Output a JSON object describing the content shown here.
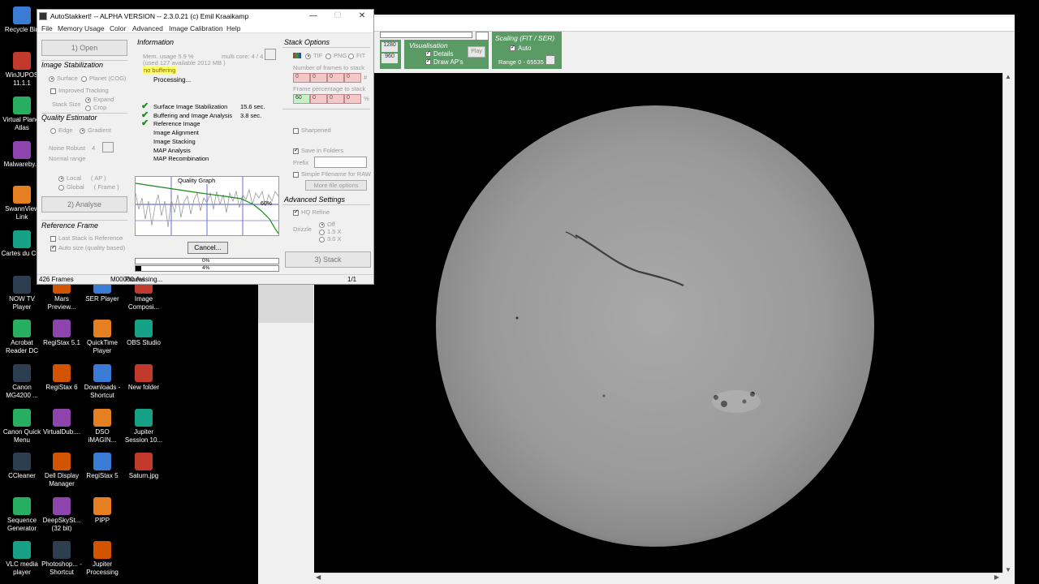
{
  "desktop_icons": [
    {
      "label": "Recycle Bin",
      "icon": "recycle-bin-icon"
    },
    {
      "label": "WinJUPOS 11.1.1",
      "icon": "winjupos-icon"
    },
    {
      "label": "Virtual Planet Atlas",
      "icon": "virtual-planet-atlas-icon"
    },
    {
      "label": "Malwareby...",
      "icon": "malwarebytes-icon"
    },
    {
      "label": "SwannView Link",
      "icon": "swannview-icon"
    },
    {
      "label": "Cartes du Ciel",
      "icon": "cartes-du-ciel-icon"
    },
    {
      "label": "NOW TV Player",
      "icon": "nowtv-icon"
    },
    {
      "label": "Mars Preview...",
      "icon": "mars-preview-icon"
    },
    {
      "label": "SER Player",
      "icon": "ser-player-icon"
    },
    {
      "label": "Image Composi...",
      "icon": "image-composite-icon"
    },
    {
      "label": "Acrobat Reader DC",
      "icon": "acrobat-icon"
    },
    {
      "label": "RegiStax 5.1",
      "icon": "registax-icon"
    },
    {
      "label": "QuickTime Player",
      "icon": "quicktime-icon"
    },
    {
      "label": "OBS Studio",
      "icon": "obs-icon"
    },
    {
      "label": "Canon MG4200 ...",
      "icon": "canon-printer-icon"
    },
    {
      "label": "RegiStax 6",
      "icon": "registax-icon"
    },
    {
      "label": "Downloads - Shortcut",
      "icon": "downloads-icon"
    },
    {
      "label": "New folder",
      "icon": "folder-icon"
    },
    {
      "label": "Canon Quick Menu",
      "icon": "canon-quick-menu-icon"
    },
    {
      "label": "VirtualDub....",
      "icon": "virtualdub-icon"
    },
    {
      "label": "DSO iMAGIN...",
      "icon": "dso-imaging-icon"
    },
    {
      "label": "Jupiter Session 10...",
      "icon": "document-icon"
    },
    {
      "label": "CCleaner",
      "icon": "ccleaner-icon"
    },
    {
      "label": "Dell Display Manager",
      "icon": "dell-display-icon"
    },
    {
      "label": "RegiStax 5",
      "icon": "registax-icon"
    },
    {
      "label": "Saturn.jpg",
      "icon": "image-file-icon"
    },
    {
      "label": "Sequence Generator",
      "icon": "sequence-generator-icon"
    },
    {
      "label": "DeepSkySt... (32 bit)",
      "icon": "deepskystacker-icon"
    },
    {
      "label": "PIPP",
      "icon": "pipp-icon"
    },
    {
      "label": "VLC media player",
      "icon": "vlc-icon"
    },
    {
      "label": "Photoshop... - Shortcut",
      "icon": "photoshop-icon"
    },
    {
      "label": "Jupiter Processing",
      "icon": "document-icon"
    }
  ],
  "ser_player": {
    "toolbar_values": {
      "width": "1280",
      "height": "960"
    },
    "visualisation": {
      "title": "Visualisation",
      "details": "Details",
      "draw_aps": "Draw AP's",
      "play": "Play"
    },
    "scaling": {
      "title": "Scaling (FIT / SER)",
      "auto": "Auto",
      "range": "Range 0 - 65535"
    }
  },
  "autostakkert": {
    "title": "AutoStakkert! -- ALPHA VERSION -- 2.3.0.21  (c) Emil Kraaikamp",
    "menu": [
      "File",
      "Memory Usage",
      "Color",
      "Advanced",
      "Image Calibration",
      "Help"
    ],
    "open_button": "1) Open",
    "image_stabilization": {
      "heading": "Image Stabilization",
      "surface": "Surface",
      "planet": "Planet (COG)",
      "improved_tracking": "Improved Tracking",
      "stack_size": "Stack Size",
      "expand": "Expand",
      "crop": "Crop"
    },
    "quality_estimator": {
      "heading": "Quality Estimator",
      "edge": "Edge",
      "gradient": "Gradient",
      "noise_robust": "Noise Robust",
      "noise_value": "4",
      "normal_range": "Normal range",
      "local": "Local",
      "local_ap": "( AP )",
      "global": "Global",
      "global_frame": "( Frame )"
    },
    "analyse_button": "2) Analyse",
    "reference_frame": {
      "heading": "Reference Frame",
      "last_stack": "Last Stack is Reference",
      "auto_size": "Auto size (quality based)"
    },
    "information": {
      "heading": "Information",
      "mem": "Mem. usage 5.9 %",
      "multicore": "multi core: 4 / 4",
      "used": "(used 127 available 2012 MB )",
      "buffering": "no buffering",
      "processing": "Processing...",
      "steps": [
        {
          "label": "Surface Image Stabilization",
          "time": "15.6 sec.",
          "done": true
        },
        {
          "label": "Buffering and Image Analysis",
          "time": "3.8 sec.",
          "done": true
        },
        {
          "label": "Reference Image",
          "time": "",
          "done": true
        },
        {
          "label": "Image Alignment",
          "time": "",
          "done": false
        },
        {
          "label": "Image Stacking",
          "time": "",
          "done": false
        },
        {
          "label": "MAP Analysis",
          "time": "",
          "done": false
        },
        {
          "label": "MAP Recombination",
          "time": "",
          "done": false
        }
      ]
    },
    "quality_graph": {
      "title": "Quality Graph",
      "pct_label": "60%"
    },
    "cancel_button": "Cancel...",
    "progress": [
      {
        "label": "0%",
        "value": 0
      },
      {
        "label": "4%",
        "value": 0.04
      }
    ],
    "stack_options": {
      "heading": "Stack Options",
      "formats": [
        "TIF",
        "PNG",
        "FIT"
      ],
      "frames_label": "Number of frames to stack",
      "frames_values": [
        "0",
        "0",
        "0",
        "0"
      ],
      "frames_unit": "#",
      "percent_label": "Frame percentage to stack",
      "percent_values": [
        "60",
        "0",
        "0",
        "0"
      ],
      "percent_unit": "%",
      "sharpened": "Sharpened",
      "save_in_folders": "Save in Folders",
      "prefix_label": "Prefix",
      "prefix_value": "",
      "simple_filename": "Simple Filename for RAW",
      "more_file_options": "More file options"
    },
    "advanced_settings": {
      "heading": "Advanced Settings",
      "hq_refine": "HQ Refine",
      "drizzle_label": "Drizzle",
      "drizzle_options": [
        "Off",
        "1.5 X",
        "3.0 X"
      ]
    },
    "stack_button": "3) Stack",
    "status": {
      "frames": "426 Frames",
      "file": "M00000.Avi",
      "state": "Processing...",
      "page": "1/1"
    }
  }
}
